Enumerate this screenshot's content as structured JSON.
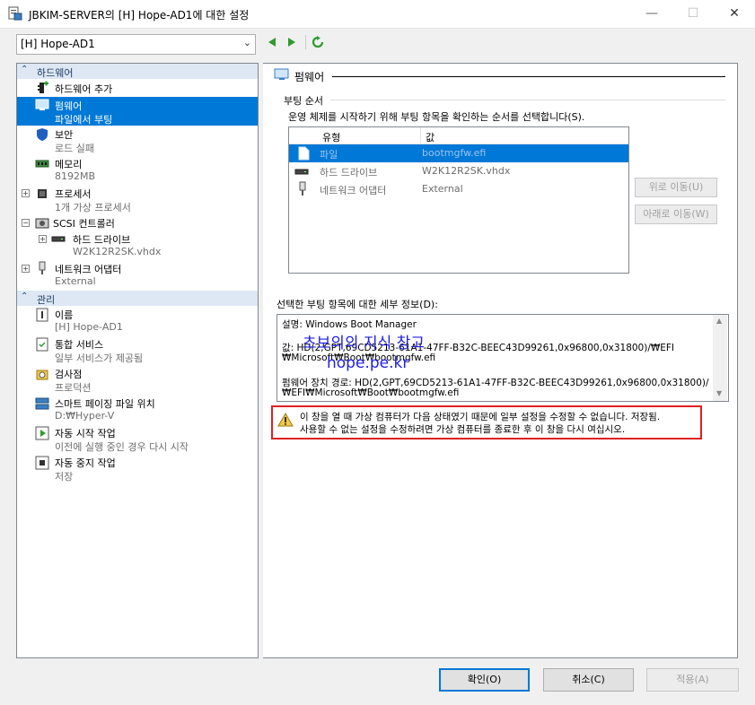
{
  "window": {
    "title": "JBKIM-SERVER의 [H] Hope-AD1에 대한 설정",
    "minimize": "—",
    "maximize": "☐",
    "close": "✕"
  },
  "vm_selector": {
    "value": "[H] Hope-AD1"
  },
  "left": {
    "hardware_category": "하드웨어",
    "management_category": "관리",
    "items": [
      {
        "label": "하드웨어 추가",
        "sub": ""
      },
      {
        "label": "펌웨어",
        "sub": "파일에서 부팅"
      },
      {
        "label": "보안",
        "sub": "로드 실패"
      },
      {
        "label": "메모리",
        "sub": "8192MB"
      },
      {
        "label": "프로세서",
        "sub": "1개 가상 프로세서"
      },
      {
        "label": "SCSI 컨트롤러",
        "sub": ""
      },
      {
        "label": "하드 드라이브",
        "sub": "W2K12R2SK.vhdx"
      },
      {
        "label": "네트워크 어댑터",
        "sub": "External"
      },
      {
        "label": "이름",
        "sub": "[H] Hope-AD1"
      },
      {
        "label": "통합 서비스",
        "sub": "일부 서비스가 제공됨"
      },
      {
        "label": "검사점",
        "sub": "프로덕션"
      },
      {
        "label": "스마트 페이징 파일 위치",
        "sub": "D:₩Hyper-V"
      },
      {
        "label": "자동 시작 작업",
        "sub": "이전에 실행 중인 경우 다시 시작"
      },
      {
        "label": "자동 중지 작업",
        "sub": "저장"
      }
    ]
  },
  "right": {
    "header": "펌웨어",
    "boot_order_group": "부팅 순서",
    "boot_order_desc": "운영 체제를 시작하기 위해 부팅 항목을 확인하는 순서를 선택합니다(S).",
    "columns": [
      "유형",
      "값"
    ],
    "boot_entries": [
      {
        "type": "파일",
        "value": "bootmgfw.efi"
      },
      {
        "type": "하드 드라이브",
        "value": "W2K12R2SK.vhdx"
      },
      {
        "type": "네트워크 어댑터",
        "value": "External"
      }
    ],
    "move_up": "위로 이동(U)",
    "move_down": "아래로 이동(W)",
    "details_label": "선택한 부팅 항목에 대한 세부 정보(D):",
    "details": [
      "설명: Windows Boot Manager",
      "값: HD(2,GPT,69CD5213-61A1-47FF-B32C-BEEC43D99261,0x96800,0x31800)/₩EFI",
      "₩Microsoft₩Boot₩bootmgfw.efi",
      "펌웨어 장치 경로: HD(2,GPT,69CD5213-61A1-47FF-B32C-BEEC43D99261,0x96800,0x31800)/",
      "₩EFI₩Microsoft₩Boot₩bootmgfw.efi"
    ],
    "warning_line1": "이 창을 열 때 가상 컴퓨터가 다음 상태였기 때문에 일부 설정을 수정할 수 없습니다. 저장됨.",
    "warning_line2": "사용할 수 없는 설정을 수정하려면 가상 컴퓨터를 종료한 후 이 창을 다시 여십시오.",
    "watermark1": "초보의의 지식 창고",
    "watermark2": "hope.pe.kr"
  },
  "buttons": {
    "ok": "확인(O)",
    "cancel": "취소(C)",
    "apply": "적용(A)"
  }
}
